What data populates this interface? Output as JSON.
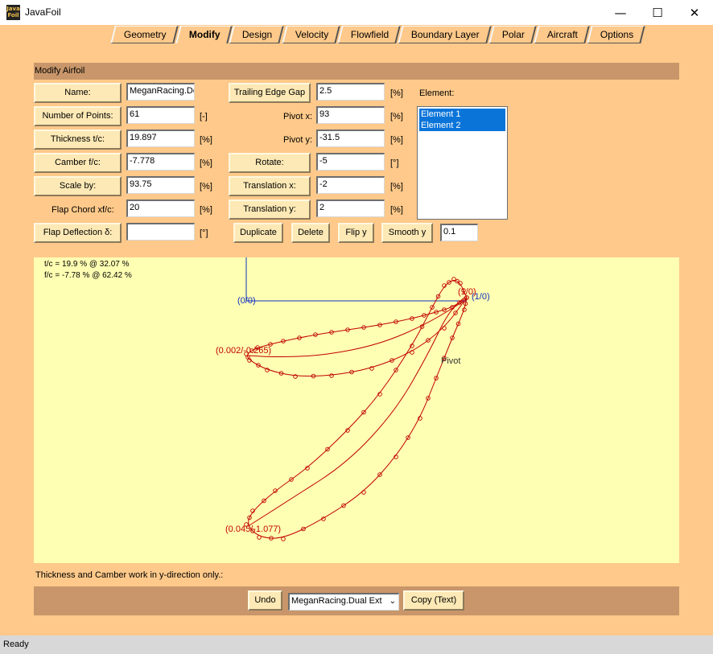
{
  "window": {
    "title": "JavaFoil",
    "icon_text": "Java Foil"
  },
  "tabs": [
    {
      "label": "Geometry"
    },
    {
      "label": "Modify"
    },
    {
      "label": "Design"
    },
    {
      "label": "Velocity"
    },
    {
      "label": "Flowfield"
    },
    {
      "label": "Boundary Layer"
    },
    {
      "label": "Polar"
    },
    {
      "label": "Aircraft"
    },
    {
      "label": "Options"
    }
  ],
  "active_tab": "Modify",
  "section_title": "Modify Airfoil",
  "left": {
    "name_button": "Name:",
    "name_value": "MeganRacing.De",
    "points_button": "Number of Points:",
    "points_value": "61",
    "points_unit": "[-]",
    "thickness_button": "Thickness  t/c:",
    "thickness_value": "19.897",
    "thickness_unit": "[%]",
    "camber_button": "Camber  f/c:",
    "camber_value": "-7.778",
    "camber_unit": "[%]",
    "scale_button": "Scale by:",
    "scale_value": "93.75",
    "scale_unit": "[%]",
    "flap_chord_label": "Flap Chord    xf/c:",
    "flap_chord_value": "20",
    "flap_chord_unit": "[%]",
    "flap_deflection_button": "Flap Deflection   δ:",
    "flap_deflection_value": "",
    "flap_deflection_unit": "[°]"
  },
  "middle": {
    "te_gap_button": "Trailing Edge Gap",
    "te_gap_value": "2.5",
    "te_gap_unit": "[%]",
    "pivot_x_label": "Pivot x:",
    "pivot_x_value": "93",
    "pivot_x_unit": "[%]",
    "pivot_y_label": "Pivot y:",
    "pivot_y_value": "-31.5",
    "pivot_y_unit": "[%]",
    "rotate_button": "Rotate:",
    "rotate_value": "-5",
    "rotate_unit": "[°]",
    "translation_x_button": "Translation x:",
    "translation_x_value": "-2",
    "translation_x_unit": "[%]",
    "translation_y_button": "Translation y:",
    "translation_y_value": "2",
    "translation_y_unit": "[%]"
  },
  "element": {
    "label": "Element:",
    "items": [
      "Element 1",
      "Element 2"
    ],
    "selected": [
      "Element 1",
      "Element 2"
    ]
  },
  "actions": {
    "duplicate": "Duplicate",
    "delete": "Delete",
    "flip_y": "Flip y",
    "smooth_y": "Smooth y",
    "smooth_value": "0.1"
  },
  "plot": {
    "stats": [
      "t/c = 19.9 % @ 32.07 %",
      "f/c = -7.78 % @ 62.42 %"
    ],
    "labels": {
      "origin": "(0/0)",
      "unit_point": "(1/0)",
      "te_label": "(1/0)",
      "element1_le": "(0.002/-0.265)",
      "element2_le": "(0.045/-1.077)",
      "pivot": "Pivot"
    }
  },
  "hint": "Thickness and Camber work in y-direction only.:",
  "bottom": {
    "undo": "Undo",
    "airfoil_select": "MeganRacing.Dual Ext",
    "copy": "Copy (Text)"
  },
  "status": "Ready"
}
